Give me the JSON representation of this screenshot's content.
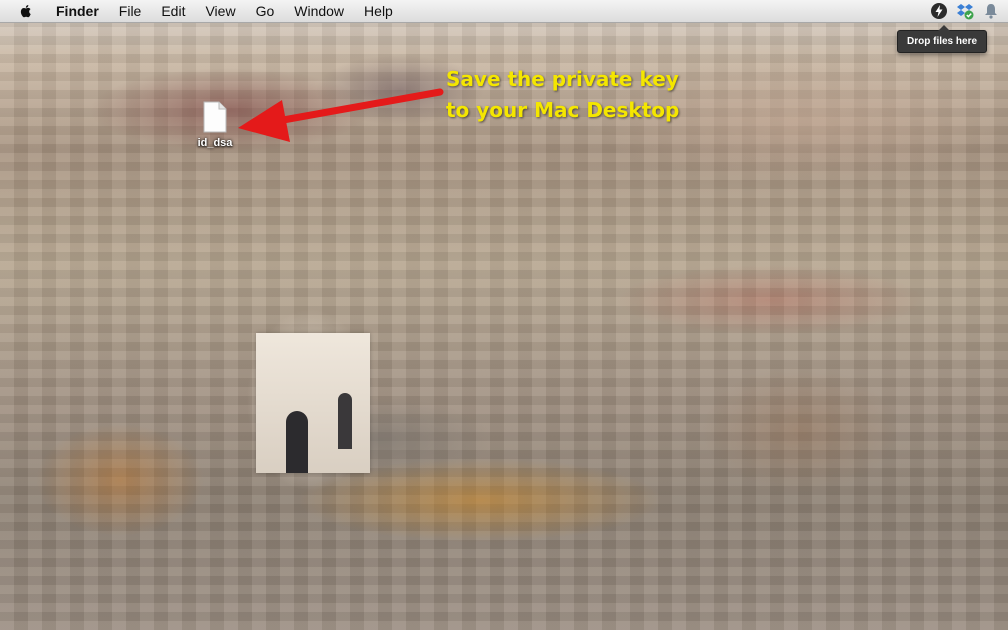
{
  "menubar": {
    "app_name": "Finder",
    "items": [
      "File",
      "Edit",
      "View",
      "Go",
      "Window",
      "Help"
    ],
    "status_icons": [
      "lightning-bolt-icon",
      "dropbox-sync-icon",
      "notification-bell-icon"
    ]
  },
  "tooltip": {
    "text": "Drop files here"
  },
  "desktop": {
    "file": {
      "name": "id_dsa",
      "icon": "document-icon"
    }
  },
  "annotation": {
    "lines": [
      "Save the private key",
      "to your Mac Desktop"
    ],
    "color": "#f4e600",
    "arrow_color": "#e41a1a"
  }
}
